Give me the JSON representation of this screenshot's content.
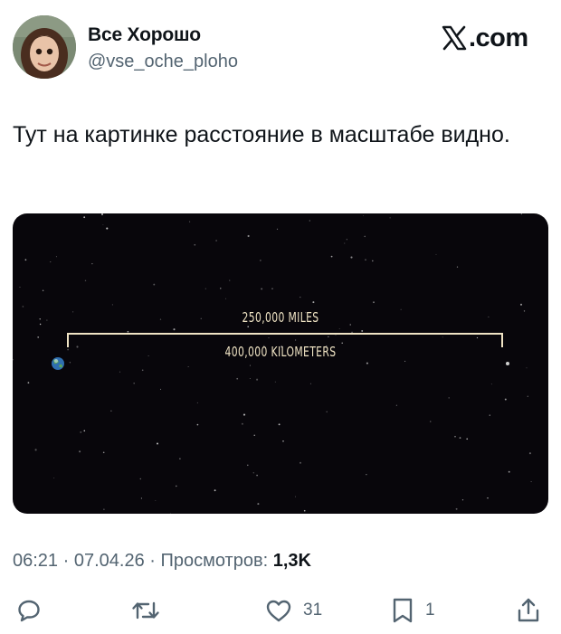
{
  "author": {
    "display_name": "Все Хорошо",
    "handle": "@vse_oche_ploho"
  },
  "brand": {
    "text": ".com",
    "icon": "x-logo-icon"
  },
  "tweet": {
    "text": "Тут на картинке расстояние в масштабе видно."
  },
  "media": {
    "miles_label": "250,000 MILES",
    "km_label": "400,000 KILOMETERS",
    "background_color": "#08060b",
    "scale_color": "#efe3c4"
  },
  "meta": {
    "time": "06:21",
    "separator": " · ",
    "date": "07.04.26",
    "views_label": "Просмотров:",
    "views_count": "1,3K"
  },
  "actions": {
    "reply": {
      "icon": "reply-icon"
    },
    "retweet": {
      "icon": "retweet-icon"
    },
    "like": {
      "icon": "heart-icon",
      "count": "31"
    },
    "bookmark": {
      "icon": "bookmark-icon",
      "count": "1"
    },
    "share": {
      "icon": "share-icon"
    }
  }
}
